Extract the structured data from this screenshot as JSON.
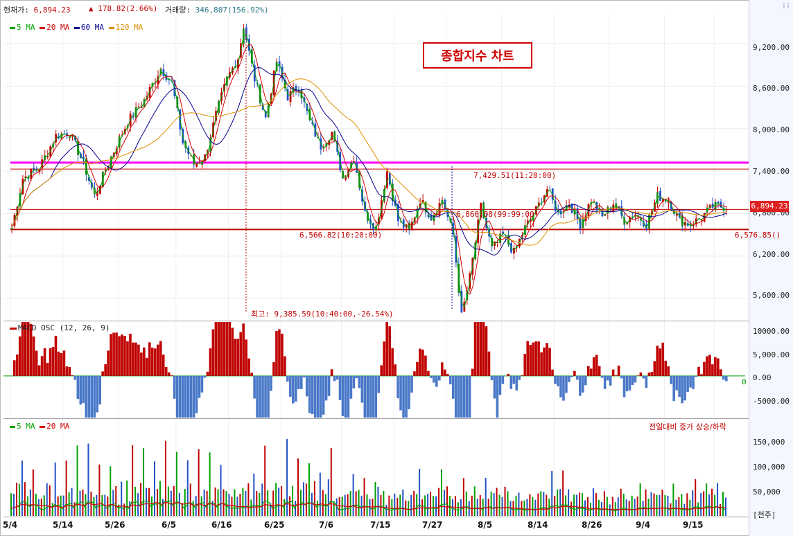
{
  "header": {
    "price_label": "현재가:",
    "price_value": "6,894.23",
    "change_value": "178.82(2.66%)",
    "volume_label": "거래량:",
    "volume_value": "346,807(156.92%)"
  },
  "colors": {
    "up": "#c00000",
    "down": "#2050c8",
    "ma5": "#00a000",
    "ma20": "#d00000",
    "ma60": "#000090",
    "ma120": "#e09000",
    "magenta": "#ff00ff",
    "macd_pos": "#c00000",
    "macd_neg": "#4a78c8"
  },
  "icons": {
    "change_arrow": "triangle-up-icon",
    "scroll": "vertical-bars-icon"
  },
  "chart_data": [
    {
      "type": "candlestick",
      "title": "종합지수 차트",
      "legend": [
        "5 MA",
        "20 MA",
        "60 MA",
        "120 MA"
      ],
      "y_ticks": [
        "9,200.00",
        "8,600.00",
        "8,000.00",
        "7,400.00",
        "6,800.00",
        "6,200.00",
        "5,600.00"
      ],
      "ylim": [
        5300,
        9600
      ],
      "x_ticks": [
        "5/4",
        "5/14",
        "5/26",
        "6/5",
        "6/16",
        "6/25",
        "7/6",
        "7/15",
        "7/27",
        "8/5",
        "8/14",
        "8/26",
        "9/4",
        "9/15"
      ],
      "keypoints": [
        [
          0,
          6600
        ],
        [
          4,
          7300
        ],
        [
          10,
          7450
        ],
        [
          16,
          7900
        ],
        [
          21,
          7950
        ],
        [
          26,
          7500
        ],
        [
          30,
          7050
        ],
        [
          36,
          7600
        ],
        [
          42,
          8100
        ],
        [
          48,
          8400
        ],
        [
          54,
          8850
        ],
        [
          58,
          8650
        ],
        [
          62,
          7800
        ],
        [
          66,
          7500
        ],
        [
          70,
          7600
        ],
        [
          74,
          8200
        ],
        [
          78,
          8700
        ],
        [
          82,
          9000
        ],
        [
          84,
          9450
        ],
        [
          88,
          8700
        ],
        [
          92,
          8150
        ],
        [
          96,
          8950
        ],
        [
          100,
          8450
        ],
        [
          104,
          8600
        ],
        [
          108,
          8100
        ],
        [
          112,
          7750
        ],
        [
          116,
          7950
        ],
        [
          120,
          7300
        ],
        [
          124,
          7600
        ],
        [
          128,
          6800
        ],
        [
          132,
          6600
        ],
        [
          136,
          7400
        ],
        [
          140,
          6700
        ],
        [
          144,
          6550
        ],
        [
          148,
          7000
        ],
        [
          152,
          6750
        ],
        [
          156,
          7000
        ],
        [
          160,
          6500
        ],
        [
          163,
          5350
        ],
        [
          166,
          5900
        ],
        [
          170,
          6900
        ],
        [
          174,
          6300
        ],
        [
          178,
          6500
        ],
        [
          182,
          6250
        ],
        [
          186,
          6600
        ],
        [
          190,
          6850
        ],
        [
          194,
          7150
        ],
        [
          198,
          6800
        ],
        [
          202,
          6950
        ],
        [
          206,
          6650
        ],
        [
          210,
          7000
        ],
        [
          214,
          6750
        ],
        [
          218,
          6950
        ],
        [
          222,
          6700
        ],
        [
          226,
          6800
        ],
        [
          230,
          6650
        ],
        [
          234,
          7050
        ],
        [
          238,
          7000
        ],
        [
          242,
          6700
        ],
        [
          246,
          6650
        ],
        [
          250,
          6750
        ],
        [
          254,
          6900
        ]
      ],
      "annotations": {
        "high": "최고: 9,385.59(10:40:00,-26.54%)",
        "h1": "7,429.51(11:20:00)",
        "h2": "6,860.08(99:99:00)",
        "h3": "6,566.82(10:20:00)",
        "h3_right": "6,576.85()",
        "current": "6,894.23"
      },
      "levels": {
        "magenta": 7520,
        "h1": 7429.51,
        "h2": 6860.08,
        "h3": 6576.85
      }
    },
    {
      "type": "bar",
      "title": "MACD OSC (12, 26, 9)",
      "y_ticks": [
        "10000.00",
        "5,000.00",
        "0.00",
        "-5000.00"
      ],
      "ylim": [
        -8500,
        11000
      ],
      "zero_label": "0"
    },
    {
      "type": "bar",
      "title": "전일대비 증가 상승/하락",
      "legend": [
        "5 MA",
        "20 MA"
      ],
      "y_ticks": [
        "150,000",
        "100,000",
        "50,000"
      ],
      "unit": "[천주]",
      "ylim": [
        0,
        170000
      ]
    }
  ]
}
